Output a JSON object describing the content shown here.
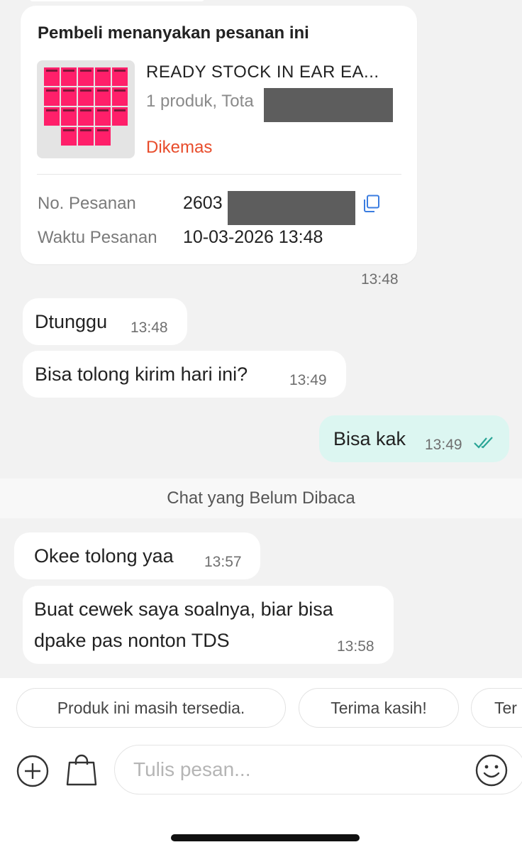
{
  "order_card": {
    "title": "Pembeli menanyakan pesanan ini",
    "product_name": "READY STOCK IN EAR EA...",
    "product_summary": "1 produk, Tota",
    "status": "Dikemas",
    "order_number_label": "No. Pesanan",
    "order_number_value": "2603",
    "order_time_label": "Waktu Pesanan",
    "order_time_value": "10-03-2026 13:48",
    "time": "13:48",
    "thumb_label": "TASTE",
    "thumb_color": "#ff1f6a"
  },
  "messages": [
    {
      "text": "Dtunggu",
      "time": "13:48",
      "direction": "in"
    },
    {
      "text": "Bisa tolong kirim hari ini?",
      "time": "13:49",
      "direction": "in"
    },
    {
      "text": "Bisa kak",
      "time": "13:49",
      "direction": "out",
      "read": true
    },
    {
      "text": "Okee tolong yaa",
      "time": "13:57",
      "direction": "in"
    },
    {
      "text_line1": "Buat cewek saya soalnya, biar bisa",
      "text_line2": "dpake pas nonton TDS",
      "time": "13:58",
      "direction": "in"
    }
  ],
  "unread_divider": "Chat yang Belum Dibaca",
  "quick_replies": [
    "Produk ini masih tersedia.",
    "Terima kasih!",
    "Ter"
  ],
  "composer": {
    "placeholder": "Tulis pesan...",
    "left_icons": [
      "plus-icon",
      "shopping-bag-icon"
    ],
    "right_icon": "emoji-icon"
  },
  "colors": {
    "background": "#f2f2f2",
    "bubble_in": "#ffffff",
    "bubble_out": "#dcf6f1",
    "status_accent": "#e84c2b",
    "read_tick": "#2aa596",
    "copy_icon": "#3b7de0"
  }
}
